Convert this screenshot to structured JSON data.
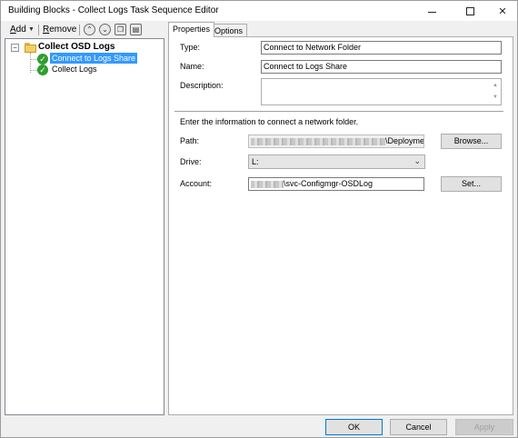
{
  "window": {
    "title": "Building Blocks - Collect Logs Task Sequence Editor"
  },
  "toolbar": {
    "add_prefix": "A",
    "add_rest": "dd",
    "remove_prefix": "R",
    "remove_rest": "emove"
  },
  "tree": {
    "group": {
      "label": "Collect OSD Logs",
      "expander": "−"
    },
    "steps": [
      {
        "label": "Connect to Logs Share",
        "selected": true
      },
      {
        "label": "Collect Logs",
        "selected": false
      }
    ]
  },
  "tabs": [
    {
      "label": "Properties",
      "active": true
    },
    {
      "label": "Options",
      "active": false
    }
  ],
  "properties": {
    "type_label": "Type:",
    "type_value": "Connect to Network Folder",
    "name_label": "Name:",
    "name_value": "Connect to Logs Share",
    "description_label": "Description:",
    "description_value": ""
  },
  "network": {
    "intro": "Enter the information to connect a network folder.",
    "path_label": "Path:",
    "path_suffix": "\\Deployment",
    "browse_label": "Browse...",
    "drive_label": "Drive:",
    "drive_value": "L:",
    "account_label": "Account:",
    "account_suffix": "\\svc-Configmgr-OSDLog",
    "set_label": "Set..."
  },
  "buttons": {
    "ok": "OK",
    "cancel": "Cancel",
    "apply": "Apply"
  },
  "colors": {
    "selection": "#3399ff",
    "check_green": "#2f9e2f",
    "default_button_border": "#0078d7"
  }
}
